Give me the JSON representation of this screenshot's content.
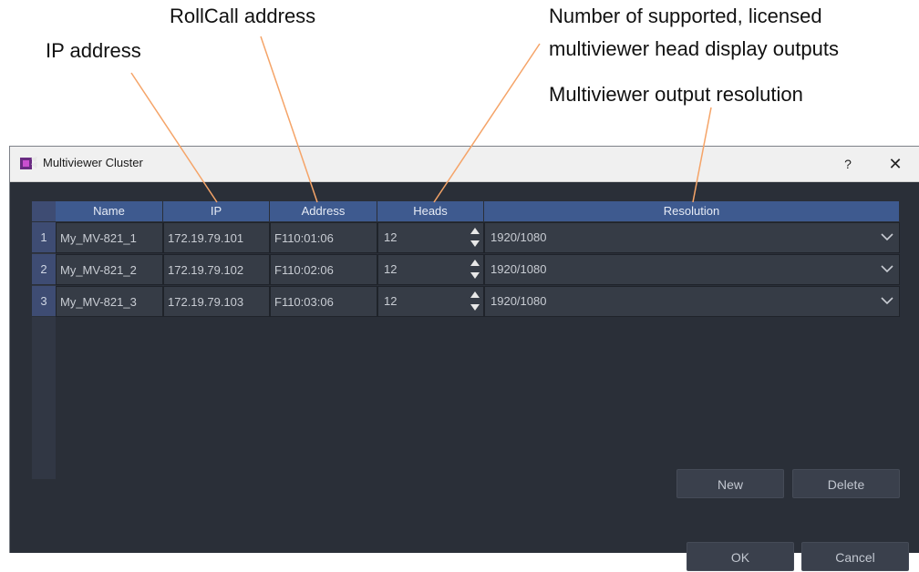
{
  "callouts": {
    "rollcall": "RollCall address",
    "ip": "IP address",
    "heads_line1": "Number of supported, licensed",
    "heads_line2": "multiviewer head display outputs",
    "resolution": "Multiviewer output resolution"
  },
  "dialog": {
    "title": "Multiviewer Cluster",
    "help": "?",
    "close": "✕",
    "columns": [
      "Name",
      "IP",
      "Address",
      "Heads",
      "Resolution"
    ],
    "rows": [
      {
        "num": "1",
        "name": "My_MV-821_1",
        "ip": "172.19.79.101",
        "address": "F110:01:06",
        "heads": "12",
        "resolution": "1920/1080"
      },
      {
        "num": "2",
        "name": "My_MV-821_2",
        "ip": "172.19.79.102",
        "address": "F110:02:06",
        "heads": "12",
        "resolution": "1920/1080"
      },
      {
        "num": "3",
        "name": "My_MV-821_3",
        "ip": "172.19.79.103",
        "address": "F110:03:06",
        "heads": "12",
        "resolution": "1920/1080"
      }
    ],
    "buttons": {
      "new": "New",
      "delete": "Delete",
      "ok": "OK",
      "cancel": "Cancel"
    }
  },
  "colors": {
    "leader_line": "#f5a468",
    "header": "#3e5a8f",
    "background": "#2a2f38"
  },
  "icons": {
    "app": "multiviewer-app-icon",
    "spinner": "up-down-arrows-icon",
    "dropdown": "chevron-down-icon"
  }
}
